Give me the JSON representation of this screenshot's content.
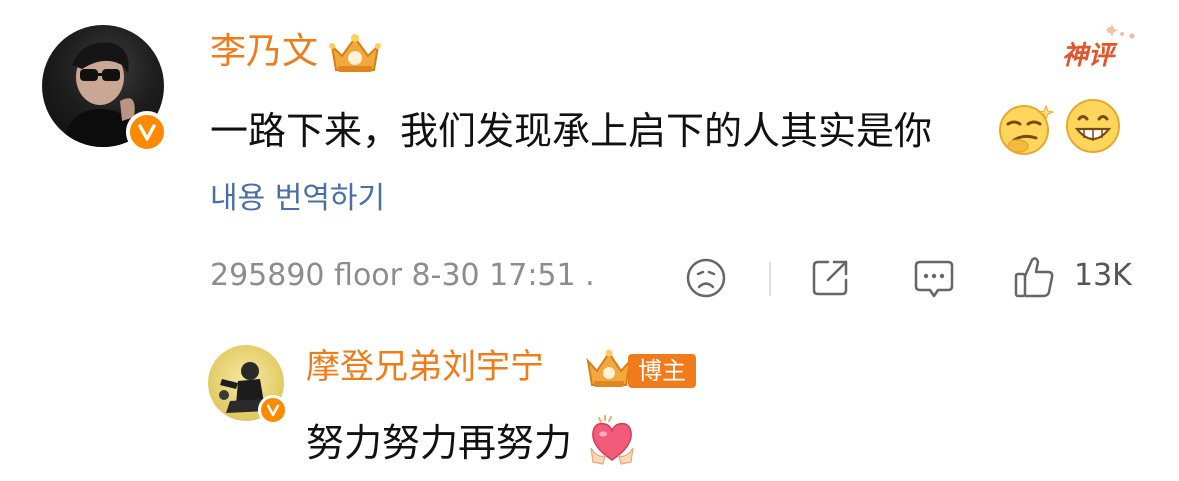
{
  "comment": {
    "username": "李乃文",
    "text": "一路下来，我们发现承上启下的人其实是你",
    "emojis": [
      "smirk-emoji",
      "grin-emoji"
    ],
    "hot_label": "神评",
    "translate_link": "내용 번역하기",
    "meta": "295890 floor 8-30 17:51 .",
    "like_count": "13K"
  },
  "reply": {
    "username": "摩登兄弟刘宇宁",
    "tag": "博主",
    "text": "努力努力再努力",
    "emoji": "heart-hands-emoji"
  },
  "colors": {
    "username": "#f07b1a",
    "link": "#4a6fa5",
    "meta": "#8c8c8c",
    "badge": "#ff8a00",
    "hot_red": "#e2552b"
  }
}
